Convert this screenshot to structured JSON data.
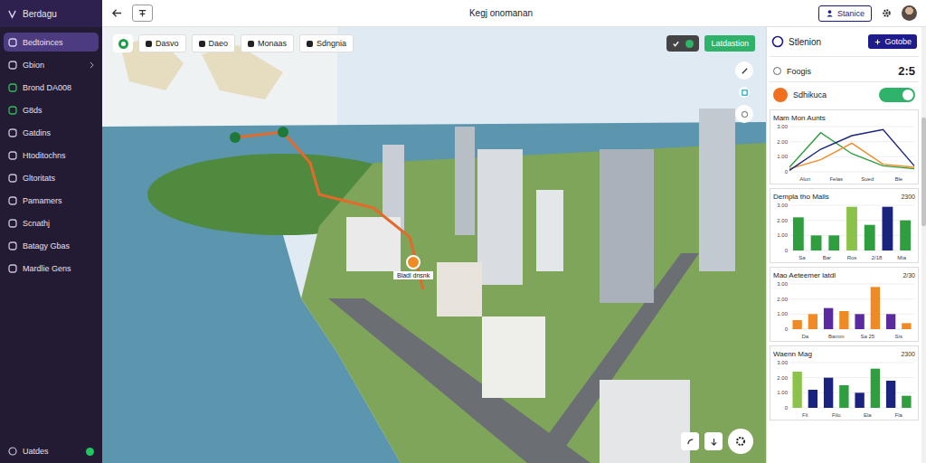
{
  "app": {
    "name": "Berdagu"
  },
  "sidebar": {
    "items": [
      {
        "label": "Bedtoinces",
        "selected": true,
        "has_chevron": false,
        "color": "#d7d0ea"
      },
      {
        "label": "Gbion",
        "selected": false,
        "has_chevron": true,
        "color": "#c9c3d9"
      },
      {
        "label": "Brond DA008",
        "selected": false,
        "has_chevron": false,
        "color": "#2ebd5a"
      },
      {
        "label": "G8ds",
        "selected": false,
        "has_chevron": false,
        "color": "#2ebd5a"
      },
      {
        "label": "Gatdins",
        "selected": false,
        "has_chevron": false,
        "color": "#c9c3d9"
      },
      {
        "label": "Htoditochns",
        "selected": false,
        "has_chevron": false,
        "color": "#c9c3d9"
      },
      {
        "label": "Gltoritats",
        "selected": false,
        "has_chevron": false,
        "color": "#c9c3d9"
      },
      {
        "label": "Pamamers",
        "selected": false,
        "has_chevron": false,
        "color": "#c9c3d9"
      },
      {
        "label": "Scnathj",
        "selected": false,
        "has_chevron": false,
        "color": "#c9c3d9"
      },
      {
        "label": "Batagy Gbas",
        "selected": false,
        "has_chevron": false,
        "color": "#c9c3d9"
      },
      {
        "label": "Mardlie Gens",
        "selected": false,
        "has_chevron": false,
        "color": "#c9c3d9"
      }
    ],
    "footer": {
      "label": "Uatdes",
      "status_color": "#22c55e"
    }
  },
  "topbar": {
    "title": "Kegj onomanan",
    "button": "Stanice"
  },
  "map": {
    "chips": [
      {
        "label": "Dasvo"
      },
      {
        "label": "Daeo"
      },
      {
        "label": "Monaas"
      },
      {
        "label": "Sdngnia"
      }
    ],
    "toggle_chip": {
      "on": true
    },
    "action_button": "Latdastion",
    "marker_label": "Bladl dnsnk"
  },
  "panel": {
    "title": "Stlenion",
    "button": "Gotobe",
    "stat": {
      "label": "Foogis",
      "value": "2:5"
    },
    "toggle": {
      "label": "Sdhikuca",
      "on": true
    },
    "charts": [
      {
        "kind": "line",
        "title": "Mam Mon Aunts",
        "y_ticks": [
          "3.00",
          "2.00",
          "1.00",
          "0"
        ],
        "x_labels": [
          "Alun",
          "Felas",
          "Sued",
          "Ble"
        ],
        "series": [
          {
            "color": "#2e9e3e",
            "values": [
              0.3,
              2.6,
              1.2,
              0.4,
              0.2
            ]
          },
          {
            "color": "#f08a24",
            "values": [
              0.2,
              0.8,
              1.9,
              0.5,
              0.3
            ]
          },
          {
            "color": "#1a237e",
            "values": [
              0.1,
              1.5,
              2.4,
              2.8,
              0.4
            ]
          }
        ]
      },
      {
        "kind": "bar",
        "title": "Dempla tho Malls",
        "badge": "2300",
        "y_ticks": [
          "3.00",
          "2.00",
          "1.00",
          "0"
        ],
        "x_labels": [
          "Sa",
          "Bar",
          "Ros",
          "2/18",
          "Mia"
        ],
        "bars": [
          {
            "value": 2.2,
            "color": "#2e9e3e"
          },
          {
            "value": 1.0,
            "color": "#2e9e3e"
          },
          {
            "value": 1.0,
            "color": "#2e9e3e"
          },
          {
            "value": 2.9,
            "color": "#8bc34a"
          },
          {
            "value": 1.7,
            "color": "#2e9e3e"
          },
          {
            "value": 2.9,
            "color": "#1a237e"
          },
          {
            "value": 2.0,
            "color": "#2e9e3e"
          }
        ]
      },
      {
        "kind": "bar",
        "title": "Mao Aeteemer latdl",
        "badge": "2/30",
        "y_ticks": [
          "3.00",
          "2.00",
          "1.00",
          "0"
        ],
        "x_labels": [
          "Da",
          "Bamm",
          "Sa 25",
          "Sis"
        ],
        "bars": [
          {
            "value": 0.6,
            "color": "#f08a24"
          },
          {
            "value": 1.0,
            "color": "#f08a24"
          },
          {
            "value": 1.4,
            "color": "#5b2a9e"
          },
          {
            "value": 1.2,
            "color": "#f08a24"
          },
          {
            "value": 1.0,
            "color": "#5b2a9e"
          },
          {
            "value": 2.8,
            "color": "#f08a24"
          },
          {
            "value": 1.0,
            "color": "#5b2a9e"
          },
          {
            "value": 0.4,
            "color": "#f08a24"
          }
        ]
      },
      {
        "kind": "bar",
        "title": "Waenn Mag",
        "badge": "2300",
        "y_ticks": [
          "3.00",
          "2.00",
          "1.00",
          "0"
        ],
        "x_labels": [
          "Fil",
          "Filo",
          "Ela",
          "Fla"
        ],
        "bars": [
          {
            "value": 2.4,
            "color": "#8bc34a"
          },
          {
            "value": 1.2,
            "color": "#1a237e"
          },
          {
            "value": 2.0,
            "color": "#1a237e"
          },
          {
            "value": 1.5,
            "color": "#2e9e3e"
          },
          {
            "value": 1.0,
            "color": "#1a237e"
          },
          {
            "value": 2.6,
            "color": "#2e9e3e"
          },
          {
            "value": 1.8,
            "color": "#1a237e"
          },
          {
            "value": 0.8,
            "color": "#2e9e3e"
          }
        ]
      }
    ]
  }
}
